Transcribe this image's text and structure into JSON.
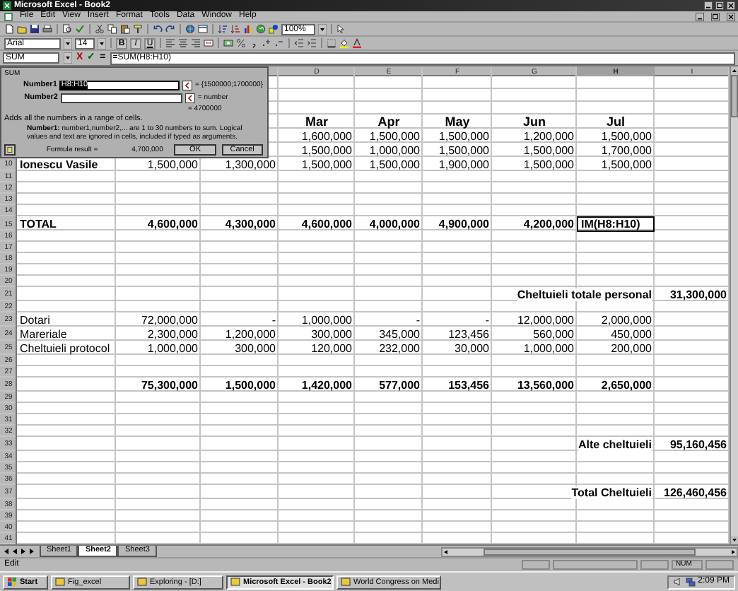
{
  "window": {
    "title": "Microsoft Excel - Book2"
  },
  "menu": [
    "File",
    "Edit",
    "View",
    "Insert",
    "Format",
    "Tools",
    "Data",
    "Window",
    "Help"
  ],
  "standard_toolbar": {
    "zoom": "100%"
  },
  "formatting_toolbar": {
    "font": "Arial",
    "size": "14",
    "bold": "B",
    "italic": "I",
    "underline": "U"
  },
  "formula_bar": {
    "name_box": "SUM",
    "cancel": "X",
    "enter": "✓",
    "equals": "=",
    "formula": "=SUM(H8:H10)"
  },
  "function_dialog": {
    "title": "SUM",
    "arguments": [
      {
        "label": "Number1",
        "value": "H8:H10",
        "selected": true,
        "result": "= {1500000;1700000}"
      },
      {
        "label": "Number2",
        "selected": false,
        "result": "= number"
      }
    ],
    "total": "= 4700000",
    "summary": "Adds all the numbers in a range of cells.",
    "help_text": "**Number1:** number1,number2,... are 1 to 30 numbers to sum. Logical values and text are ignored in cells, included if typed as arguments.",
    "result_label": "Formula result =",
    "result": "4,700,000",
    "buttons": [
      "OK",
      "Cancel"
    ]
  },
  "columns": [
    {
      "letter": "D",
      "selected": false
    },
    {
      "letter": "E",
      "selected": false
    },
    {
      "letter": "F",
      "selected": false
    },
    {
      "letter": "G",
      "selected": false
    },
    {
      "letter": "H",
      "selected": true
    },
    {
      "letter": "I",
      "selected": false
    }
  ],
  "rows": [
    {
      "cells": {
        "D": {
          "text": "Mar",
          "kind": "heading",
          "bold": true
        },
        "E": {
          "text": "Apr",
          "kind": "heading",
          "bold": true
        },
        "F": {
          "text": "May",
          "kind": "heading",
          "bold": true
        },
        "G": {
          "text": "Jun",
          "kind": "heading",
          "bold": true
        },
        "H": {
          "text": "Jul",
          "kind": "heading",
          "bold": true
        }
      }
    },
    {
      "cells": {
        "D": {
          "text": "1,600,000",
          "kind": "number",
          "bold": false
        },
        "E": {
          "text": "1,500,000",
          "kind": "number",
          "bold": false
        },
        "F": {
          "text": "1,500,000",
          "kind": "number",
          "bold": false
        },
        "G": {
          "text": "1,200,000",
          "kind": "number",
          "bold": false
        },
        "H": {
          "text": "1,500,000",
          "kind": "number",
          "bold": false
        }
      }
    },
    {
      "cells": {
        "D": {
          "text": "1,500,000",
          "kind": "number",
          "bold": false
        },
        "E": {
          "text": "1,000,000",
          "kind": "number",
          "bold": false
        },
        "F": {
          "text": "1,500,000",
          "kind": "number",
          "bold": false
        },
        "G": {
          "text": "1,500,000",
          "kind": "number",
          "bold": false
        },
        "H": {
          "text": "1,700,000",
          "kind": "number",
          "bold": false
        }
      }
    },
    {
      "number": "10",
      "cells": {
        "A": {
          "text": "Ionescu Vasile",
          "kind": "text",
          "bold": true
        },
        "B": {
          "text": "1,500,000",
          "kind": "number",
          "bold": false
        },
        "C": {
          "text": "1,300,000",
          "kind": "number",
          "bold": false
        },
        "D": {
          "text": "1,500,000",
          "kind": "number",
          "bold": false
        },
        "E": {
          "text": "1,500,000",
          "kind": "number",
          "bold": false
        },
        "F": {
          "text": "1,900,000",
          "kind": "number",
          "bold": false
        },
        "G": {
          "text": "1,500,000",
          "kind": "number",
          "bold": false
        },
        "H": {
          "text": "1,500,000",
          "kind": "number",
          "bold": false
        }
      }
    },
    {
      "number": "11"
    },
    {
      "number": "12"
    },
    {
      "number": "13"
    },
    {
      "number": "14"
    },
    {
      "number": "15",
      "cells": {
        "A": {
          "text": "TOTAL",
          "kind": "text",
          "bold": true
        },
        "B": {
          "text": "4,600,000",
          "kind": "number",
          "bold": true
        },
        "C": {
          "text": "4,300,000",
          "kind": "number",
          "bold": true
        },
        "D": {
          "text": "4,600,000",
          "kind": "number",
          "bold": true
        },
        "E": {
          "text": "4,000,000",
          "kind": "number",
          "bold": true
        },
        "F": {
          "text": "4,900,000",
          "kind": "number",
          "bold": true
        },
        "G": {
          "text": "4,200,000",
          "kind": "number",
          "bold": true
        },
        "H": {
          "text": "IM(H8:H10)",
          "kind": "editing",
          "bold": true
        }
      }
    },
    {
      "number": "16"
    },
    {
      "number": "17"
    },
    {
      "number": "18"
    },
    {
      "number": "19"
    },
    {
      "number": "20"
    },
    {
      "number": "21",
      "cells": {
        "H": {
          "text": "Cheltuieli totale personal",
          "kind": "caption",
          "bold": true
        },
        "I": {
          "text": "31,300,000",
          "kind": "number",
          "bold": true
        }
      }
    },
    {
      "number": "22"
    },
    {
      "number": "23",
      "cells": {
        "A": {
          "text": "Dotari",
          "kind": "text",
          "bold": false
        },
        "B": {
          "text": "72,000,000",
          "kind": "number",
          "bold": false
        },
        "C": {
          "text": "-",
          "kind": "number",
          "bold": false
        },
        "D": {
          "text": "1,000,000",
          "kind": "number",
          "bold": false
        },
        "E": {
          "text": "-",
          "kind": "number",
          "bold": false
        },
        "F": {
          "text": "-",
          "kind": "number",
          "bold": false
        },
        "G": {
          "text": "12,000,000",
          "kind": "number",
          "bold": false
        },
        "H": {
          "text": "2,000,000",
          "kind": "number",
          "bold": false
        }
      }
    },
    {
      "number": "24",
      "cells": {
        "A": {
          "text": "Mareriale",
          "kind": "text",
          "bold": false
        },
        "B": {
          "text": "2,300,000",
          "kind": "number",
          "bold": false
        },
        "C": {
          "text": "1,200,000",
          "kind": "number",
          "bold": false
        },
        "D": {
          "text": "300,000",
          "kind": "number",
          "bold": false
        },
        "E": {
          "text": "345,000",
          "kind": "number",
          "bold": false
        },
        "F": {
          "text": "123,456",
          "kind": "number",
          "bold": false
        },
        "G": {
          "text": "560,000",
          "kind": "number",
          "bold": false
        },
        "H": {
          "text": "450,000",
          "kind": "number",
          "bold": false
        }
      }
    },
    {
      "number": "25",
      "cells": {
        "A": {
          "text": "Cheltuieli protocol",
          "kind": "text",
          "bold": false
        },
        "B": {
          "text": "1,000,000",
          "kind": "number",
          "bold": false
        },
        "C": {
          "text": "300,000",
          "kind": "number",
          "bold": false
        },
        "D": {
          "text": "120,000",
          "kind": "number",
          "bold": false
        },
        "E": {
          "text": "232,000",
          "kind": "number",
          "bold": false
        },
        "F": {
          "text": "30,000",
          "kind": "number",
          "bold": false
        },
        "G": {
          "text": "1,000,000",
          "kind": "number",
          "bold": false
        },
        "H": {
          "text": "200,000",
          "kind": "number",
          "bold": false
        }
      }
    },
    {
      "number": "26"
    },
    {
      "number": "27"
    },
    {
      "number": "28",
      "cells": {
        "B": {
          "text": "75,300,000",
          "kind": "number",
          "bold": true
        },
        "C": {
          "text": "1,500,000",
          "kind": "number",
          "bold": true
        },
        "D": {
          "text": "1,420,000",
          "kind": "number",
          "bold": true
        },
        "E": {
          "text": "577,000",
          "kind": "number",
          "bold": true
        },
        "F": {
          "text": "153,456",
          "kind": "number",
          "bold": true
        },
        "G": {
          "text": "13,560,000",
          "kind": "number",
          "bold": true
        },
        "H": {
          "text": "2,650,000",
          "kind": "number",
          "bold": true
        }
      }
    },
    {
      "number": "29"
    },
    {
      "number": "30"
    },
    {
      "number": "31"
    },
    {
      "number": "32"
    },
    {
      "number": "33",
      "cells": {
        "H": {
          "text": "Alte cheltuieli",
          "kind": "caption",
          "bold": true
        },
        "I": {
          "text": "95,160,456",
          "kind": "number",
          "bold": true
        }
      }
    },
    {
      "number": "34"
    },
    {
      "number": "35"
    },
    {
      "number": "36"
    },
    {
      "number": "37",
      "cells": {
        "H": {
          "text": "Total Cheltuieli",
          "kind": "caption",
          "bold": true
        },
        "I": {
          "text": "126,460,456",
          "kind": "number",
          "bold": true
        }
      }
    },
    {
      "number": "38"
    },
    {
      "number": "39"
    },
    {
      "number": "40"
    },
    {
      "number": "41"
    }
  ],
  "sheet_tabs": [
    {
      "label": "Sheet1",
      "selected": false
    },
    {
      "label": "Sheet2",
      "selected": true
    },
    {
      "label": "Sheet3",
      "selected": false
    }
  ],
  "status_bar": {
    "mode": "Edit",
    "num": "NUM"
  },
  "taskbar": {
    "start": "Start",
    "items": [
      {
        "label": "Fig_excel",
        "selected": false
      },
      {
        "label": "Exploring - [D:]",
        "selected": false
      },
      {
        "label": "Microsoft Excel - Book2",
        "selected": true
      },
      {
        "label": "World Congress on Medi",
        "selected": false
      }
    ],
    "clock": "2:09 PM"
  }
}
